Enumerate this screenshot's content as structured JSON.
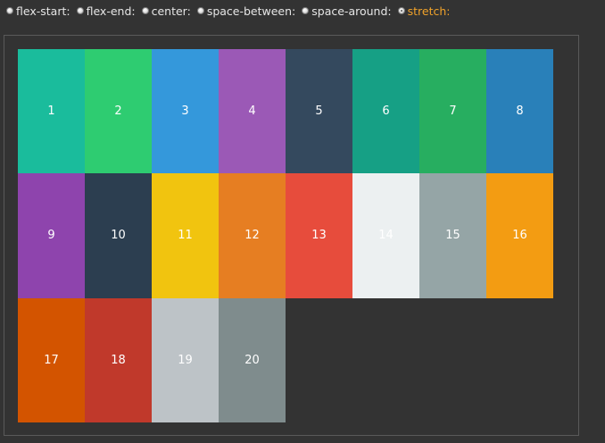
{
  "options": [
    {
      "label": "flex-start:",
      "checked": false
    },
    {
      "label": "flex-end:",
      "checked": false
    },
    {
      "label": "center:",
      "checked": false
    },
    {
      "label": "space-between:",
      "checked": false
    },
    {
      "label": "space-around:",
      "checked": false
    },
    {
      "label": "stretch:",
      "checked": true
    }
  ],
  "tiles": [
    {
      "label": "1",
      "color": "#1abc9c"
    },
    {
      "label": "2",
      "color": "#2ecc71"
    },
    {
      "label": "3",
      "color": "#3498db"
    },
    {
      "label": "4",
      "color": "#9b59b6"
    },
    {
      "label": "5",
      "color": "#34495e"
    },
    {
      "label": "6",
      "color": "#16a085"
    },
    {
      "label": "7",
      "color": "#27ae60"
    },
    {
      "label": "8",
      "color": "#2980b9"
    },
    {
      "label": "9",
      "color": "#8e44ad"
    },
    {
      "label": "10",
      "color": "#2c3e50"
    },
    {
      "label": "11",
      "color": "#f1c40f"
    },
    {
      "label": "12",
      "color": "#e67e22"
    },
    {
      "label": "13",
      "color": "#e74c3c"
    },
    {
      "label": "14",
      "color": "#ecf0f1"
    },
    {
      "label": "15",
      "color": "#95a5a6"
    },
    {
      "label": "16",
      "color": "#f39c12"
    },
    {
      "label": "17",
      "color": "#d35400"
    },
    {
      "label": "18",
      "color": "#c0392b"
    },
    {
      "label": "19",
      "color": "#bdc3c7"
    },
    {
      "label": "20",
      "color": "#7f8c8d"
    }
  ]
}
